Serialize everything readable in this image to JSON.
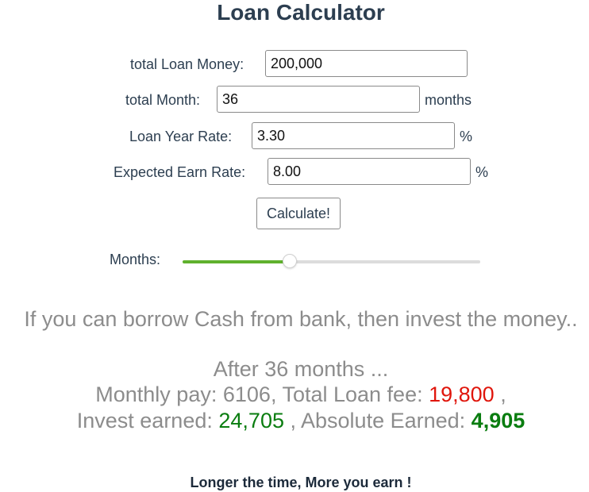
{
  "title": "Loan Calculator",
  "form": {
    "loan_money": {
      "label": "total Loan Money:",
      "value": "200,000"
    },
    "total_month": {
      "label": "total Month:",
      "value": "36",
      "unit": "months"
    },
    "loan_rate": {
      "label": "Loan Year Rate:",
      "value": "3.30",
      "unit": "%"
    },
    "earn_rate": {
      "label": "Expected Earn Rate:",
      "value": "8.00",
      "unit": "%"
    },
    "calculate_label": "Calculate!"
  },
  "slider": {
    "label": "Months:",
    "fill_fraction": 0.36,
    "fill_color": "#5fb12d",
    "track_color": "#dcdcdc"
  },
  "results": {
    "intro": "If you can borrow Cash from bank, then invest the money..",
    "after": "After 36 months ...",
    "monthly_pay_label": "Monthly pay:",
    "monthly_pay_value": "6106",
    "total_loan_fee_label": ", Total Loan fee:",
    "total_loan_fee_value": "19,800",
    "comma": ",",
    "invest_earned_label": "Invest earned:",
    "invest_earned_value": "24,705",
    "absolute_earned_label": ", Absolute Earned:",
    "absolute_earned_value": "4,905"
  },
  "footer": "Longer the time, More you earn !",
  "colors": {
    "text": "#2c3e50",
    "muted": "#8c8c8c",
    "fee_red": "#e0160c",
    "earned_green": "#0a7d10"
  }
}
